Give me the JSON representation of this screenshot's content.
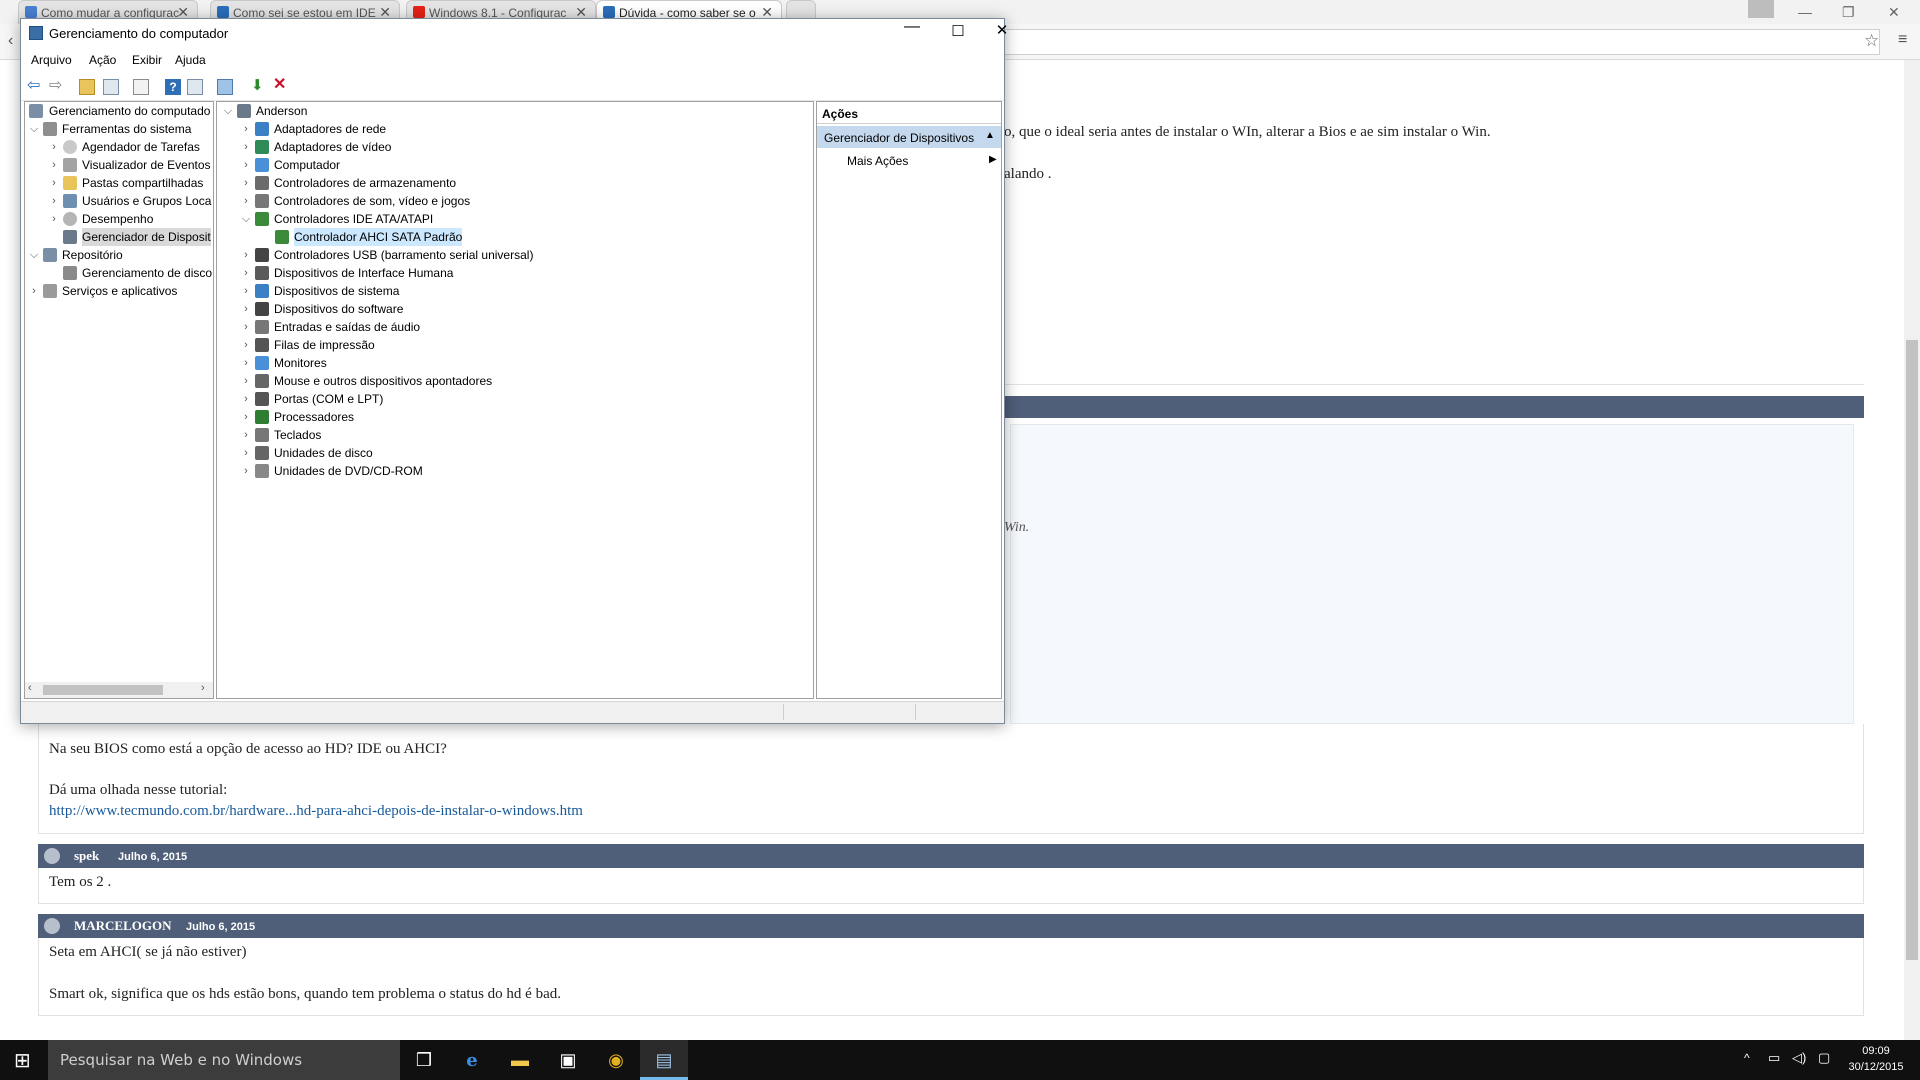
{
  "browser": {
    "tabs": [
      {
        "title": "Como mudar a configurac",
        "icon_color": "#4a7fd4"
      },
      {
        "title": "Como sei se estou em IDE",
        "icon_color": "#2a6ebb"
      },
      {
        "title": "Windows 8.1 - Configurac",
        "icon_color": "#e62117"
      },
      {
        "title": "Dúvida - como saber se o",
        "icon_color": "#2a6ebb"
      }
    ]
  },
  "page": {
    "snippet1": "o, que o ideal seria antes de instalar o WIn, alterar a Bios e ae sim instalar o Win.",
    "snippet2": "alando .",
    "snippet3": "Win.",
    "post1": {
      "line1": "Na seu BIOS como está a opção de acesso ao HD? IDE ou AHCI?",
      "line2": "Dá uma olhada nesse tutorial:",
      "link": "http://www.tecmundo.com.br/hardware...hd-para-ahci-depois-de-instalar-o-windows.htm"
    },
    "post2": {
      "user": "spek",
      "date": "Julho 6, 2015",
      "text": "Tem os 2 ."
    },
    "post3": {
      "user": "MARCELOGON",
      "date": "Julho 6, 2015",
      "line1": "Seta em AHCI( se já não estiver)",
      "line2": "Smart ok, significa que os hds estão bons, quando tem problema o status do hd é bad."
    }
  },
  "mmc": {
    "title": "Gerenciamento do computador",
    "menu": [
      "Arquivo",
      "Ação",
      "Exibir",
      "Ajuda"
    ],
    "left_tree": [
      {
        "label": "Gerenciamento do computado",
        "level": 0,
        "expander": ""
      },
      {
        "label": "Ferramentas do sistema",
        "level": 1,
        "expander": "expanded"
      },
      {
        "label": "Agendador de Tarefas",
        "level": 2,
        "expander": "collapsed"
      },
      {
        "label": "Visualizador de Eventos",
        "level": 2,
        "expander": "collapsed"
      },
      {
        "label": "Pastas compartilhadas",
        "level": 2,
        "expander": "collapsed"
      },
      {
        "label": "Usuários e Grupos Loca",
        "level": 2,
        "expander": "collapsed"
      },
      {
        "label": "Desempenho",
        "level": 2,
        "expander": "collapsed"
      },
      {
        "label": "Gerenciador de Disposit",
        "level": 2,
        "expander": "",
        "selected": true
      },
      {
        "label": "Repositório",
        "level": 1,
        "expander": "expanded"
      },
      {
        "label": "Gerenciamento de disco",
        "level": 2,
        "expander": ""
      },
      {
        "label": "Serviços e aplicativos",
        "level": 1,
        "expander": "collapsed"
      }
    ],
    "device_root": "Anderson",
    "devices": [
      {
        "label": "Adaptadores de rede",
        "expander": "collapsed",
        "icon_color": "#3b7fc4"
      },
      {
        "label": "Adaptadores de vídeo",
        "expander": "collapsed",
        "icon_color": "#2e8b57"
      },
      {
        "label": "Computador",
        "expander": "collapsed",
        "icon_color": "#4a90d9"
      },
      {
        "label": "Controladores de armazenamento",
        "expander": "collapsed",
        "icon_color": "#6b6b6b"
      },
      {
        "label": "Controladores de som, vídeo e jogos",
        "expander": "collapsed",
        "icon_color": "#777777"
      },
      {
        "label": "Controladores IDE ATA/ATAPI",
        "expander": "expanded",
        "icon_color": "#3a8a3a"
      },
      {
        "label": "Controlador AHCI SATA Padrão",
        "expander": "",
        "icon_color": "#3a8a3a",
        "child": true,
        "selected": true
      },
      {
        "label": "Controladores USB (barramento serial universal)",
        "expander": "collapsed",
        "icon_color": "#444444"
      },
      {
        "label": "Dispositivos de Interface Humana",
        "expander": "collapsed",
        "icon_color": "#5a5a5a"
      },
      {
        "label": "Dispositivos de sistema",
        "expander": "collapsed",
        "icon_color": "#3b7fc4"
      },
      {
        "label": "Dispositivos do software",
        "expander": "collapsed",
        "icon_color": "#444444"
      },
      {
        "label": "Entradas e saídas de áudio",
        "expander": "collapsed",
        "icon_color": "#777777"
      },
      {
        "label": "Filas de impressão",
        "expander": "collapsed",
        "icon_color": "#555555"
      },
      {
        "label": "Monitores",
        "expander": "collapsed",
        "icon_color": "#4a90d9"
      },
      {
        "label": "Mouse e outros dispositivos apontadores",
        "expander": "collapsed",
        "icon_color": "#666666"
      },
      {
        "label": "Portas (COM e LPT)",
        "expander": "collapsed",
        "icon_color": "#555555"
      },
      {
        "label": "Processadores",
        "expander": "collapsed",
        "icon_color": "#2e7d32"
      },
      {
        "label": "Teclados",
        "expander": "collapsed",
        "icon_color": "#777777"
      },
      {
        "label": "Unidades de disco",
        "expander": "collapsed",
        "icon_color": "#666666"
      },
      {
        "label": "Unidades de DVD/CD-ROM",
        "expander": "collapsed",
        "icon_color": "#888888"
      }
    ],
    "actions": {
      "header": "Ações",
      "section": "Gerenciador de Dispositivos",
      "more": "Mais Ações"
    }
  },
  "taskbar": {
    "search_placeholder": "Pesquisar na Web e no Windows",
    "time": "09:09",
    "date": "30/12/2015"
  },
  "colors": {
    "post_bar": "#4f5e79",
    "link": "#1a5a9a",
    "selection": "#cce8ff",
    "actions_section": "#c5d9ee"
  }
}
